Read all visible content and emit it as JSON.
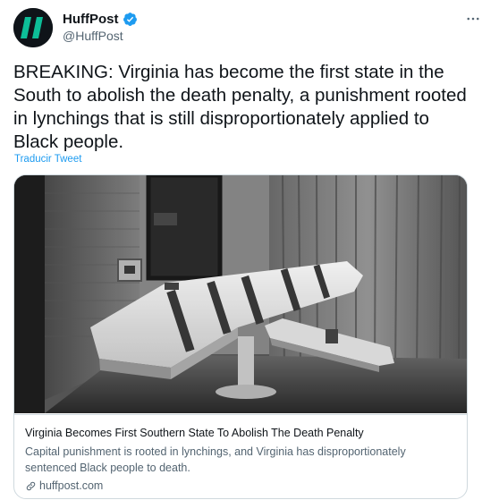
{
  "account": {
    "display_name": "HuffPost",
    "handle": "@HuffPost",
    "verified": true,
    "avatar_icon": "huffpost-logo-icon"
  },
  "tweet": {
    "text": "BREAKING: Virginia has become the first state in the South to abolish the death penalty, a punishment rooted in lynchings that is still disproportionately applied to Black people.",
    "translate_label": "Traducir Tweet"
  },
  "card": {
    "image_icon": "execution-chamber-photo",
    "title": "Virginia Becomes First Southern State To Abolish The Death Penalty",
    "description": "Capital punishment is rooted in lynchings, and Virginia has disproportionately sentenced Black people to death.",
    "domain": "huffpost.com",
    "domain_icon": "link-icon"
  },
  "colors": {
    "accent": "#1d9bf0",
    "text_primary": "#0f1419",
    "text_secondary": "#536471",
    "border": "#cfd9de",
    "logo_green": "#0dbe98"
  }
}
